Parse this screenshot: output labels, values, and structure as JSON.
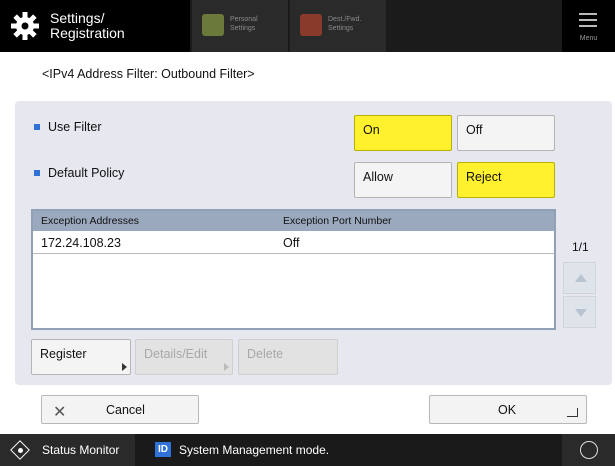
{
  "topbar": {
    "title_line1": "Settings/",
    "title_line2": "Registration",
    "personal_line1": "Personal",
    "personal_line2": "Settings",
    "dest_line1": "Dest./Fwd.",
    "dest_line2": "Settings",
    "menu_label": "Menu"
  },
  "page_title": "<IPv4 Address Filter: Outbound Filter>",
  "use_filter": {
    "label": "Use Filter",
    "on_label": "On",
    "off_label": "Off",
    "selected": "On"
  },
  "default_policy": {
    "label": "Default Policy",
    "allow_label": "Allow",
    "reject_label": "Reject",
    "selected": "Reject"
  },
  "table": {
    "headers": [
      "Exception Addresses",
      "Exception Port Number"
    ],
    "rows": [
      {
        "address": "172.24.108.23",
        "port": "Off"
      }
    ]
  },
  "pagination": {
    "text": "1/1"
  },
  "actions": {
    "register_label": "Register",
    "details_label": "Details/Edit",
    "delete_label": "Delete"
  },
  "footer": {
    "cancel_label": "Cancel",
    "ok_label": "OK"
  },
  "statusbar": {
    "monitor_label": "Status Monitor",
    "id_badge": "ID",
    "mode_text": "System Management mode."
  },
  "colors": {
    "selected": "#fff12e",
    "accent": "#2f73d8",
    "panel": "#e6e7ef"
  }
}
